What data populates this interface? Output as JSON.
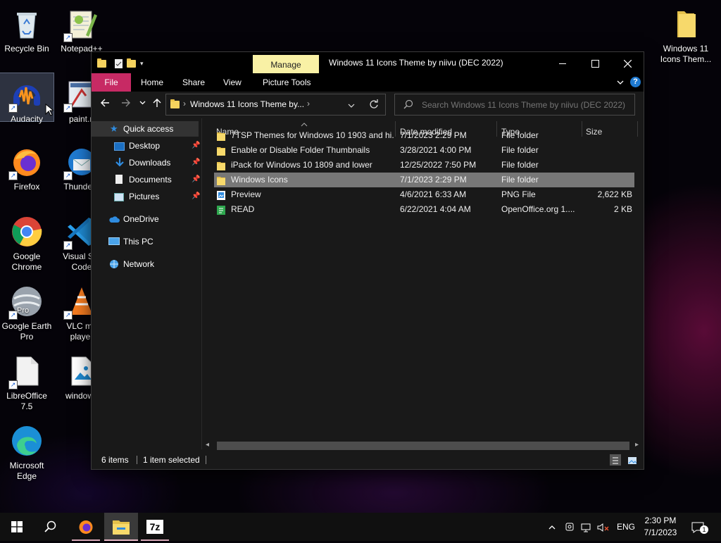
{
  "desktop": {
    "icons": [
      {
        "label": "Recycle Bin"
      },
      {
        "label": "Notepad++"
      },
      {
        "label": "Audacity"
      },
      {
        "label": "paint.n"
      },
      {
        "label": "Firefox"
      },
      {
        "label": "Thunderb"
      },
      {
        "label": "Google Chrome"
      },
      {
        "label": "Visual Stu Code"
      },
      {
        "label": "Google Earth Pro"
      },
      {
        "label": "VLC me player"
      },
      {
        "label": "LibreOffice 7.5"
      },
      {
        "label": "windows"
      },
      {
        "label": "Microsoft Edge"
      },
      {
        "label": "Windows 11 Icons Them..."
      }
    ],
    "earth_badge": "Pro"
  },
  "window": {
    "title": "Windows 11 Icons Theme by niivu (DEC 2022)",
    "contextual_tab": "Manage",
    "ribbon_tabs": [
      "File",
      "Home",
      "Share",
      "View",
      "Picture Tools"
    ],
    "controls": {
      "minimize": "—",
      "maximize": "☐",
      "close": "✕"
    },
    "address": "Windows 11 Icons Theme by...",
    "search_placeholder": "Search Windows 11 Icons Theme by niivu (DEC 2022)",
    "help": "?"
  },
  "nav": {
    "quick_access": "Quick access",
    "pinned": [
      {
        "label": "Desktop"
      },
      {
        "label": "Downloads"
      },
      {
        "label": "Documents"
      },
      {
        "label": "Pictures"
      }
    ],
    "onedrive": "OneDrive",
    "thispc": "This PC",
    "network": "Network"
  },
  "filelist": {
    "columns": [
      "Name",
      "Date modified",
      "Type",
      "Size"
    ],
    "rows": [
      {
        "name": "7TSP Themes for Windows 10 1903 and hi...",
        "date": "7/1/2023 2:29 PM",
        "type": "File folder",
        "size": "",
        "icon": "folder-icon"
      },
      {
        "name": "Enable or Disable Folder Thumbnails",
        "date": "3/28/2021 4:00 PM",
        "type": "File folder",
        "size": "",
        "icon": "folder-icon"
      },
      {
        "name": "iPack for Windows 10 1809 and lower",
        "date": "12/25/2022 7:50 PM",
        "type": "File folder",
        "size": "",
        "icon": "folder-icon"
      },
      {
        "name": "Windows Icons",
        "date": "7/1/2023 2:29 PM",
        "type": "File folder",
        "size": "",
        "icon": "folder-icon",
        "selected": true
      },
      {
        "name": "Preview",
        "date": "4/6/2021 6:33 AM",
        "type": "PNG File",
        "size": "2,622 KB",
        "icon": "png-file-icon"
      },
      {
        "name": "READ",
        "date": "6/22/2021 4:04 AM",
        "type": "OpenOffice.org 1....",
        "size": "2 KB",
        "icon": "odt-file-icon"
      }
    ]
  },
  "status": {
    "items": "6 items",
    "selected": "1 item selected"
  },
  "taskbar": {
    "time": "2:30 PM",
    "date": "7/1/2023",
    "lang": "ENG",
    "sevenzip": "7z",
    "notifications": "1"
  },
  "colors": {
    "file_tab": "#c72a64",
    "manage_tab": "#f9f1a5",
    "folder": "#f5d35e",
    "selected_row": "#777777"
  }
}
